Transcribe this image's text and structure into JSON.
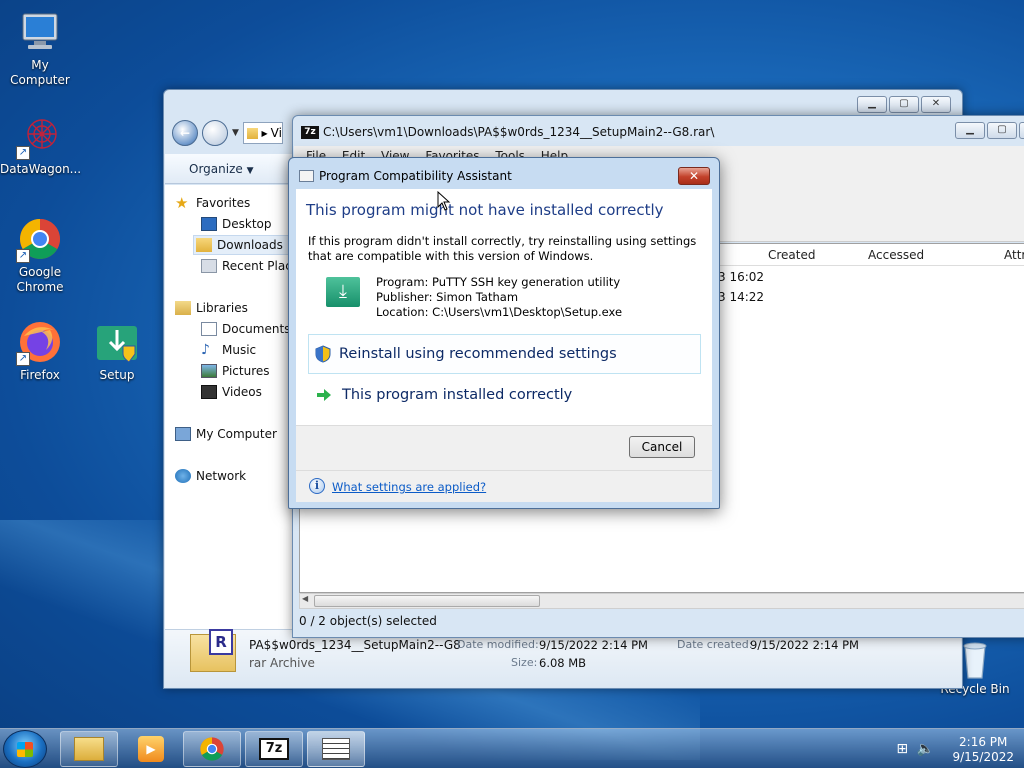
{
  "desktop": {
    "icons": [
      {
        "label": "My Computer"
      },
      {
        "label": "DataWagon..."
      },
      {
        "label": "Google Chrome"
      },
      {
        "label": "Firefox"
      },
      {
        "label": "Setup"
      },
      {
        "label": "Recycle Bin"
      }
    ]
  },
  "explorer": {
    "address_fragment": "Vi",
    "organize_label": "Organize",
    "nav": {
      "favorites": "Favorites",
      "desktop": "Desktop",
      "downloads": "Downloads",
      "recent": "Recent Places",
      "libraries": "Libraries",
      "documents": "Documents",
      "music": "Music",
      "pictures": "Pictures",
      "videos": "Videos",
      "my_computer": "My Computer",
      "network": "Network"
    },
    "details": {
      "filename": "PA$$w0rds_1234__SetupMain2--G8",
      "type": "rar Archive",
      "date_modified_label": "Date modified:",
      "date_modified": "9/15/2022 2:14 PM",
      "date_created_label": "Date created:",
      "date_created": "9/15/2022 2:14 PM",
      "size_label": "Size:",
      "size": "6.08 MB"
    }
  },
  "sevenzip": {
    "app_icon": "7z",
    "title": "C:\\Users\\vm1\\Downloads\\PA$$w0rds_1234__SetupMain2--G8.rar\\",
    "menu": [
      "File",
      "Edit",
      "View",
      "Favorites",
      "Tools",
      "Help"
    ],
    "columns": [
      "Created",
      "Accessed",
      "Attri"
    ],
    "rows": [
      {
        "time": "3 16:02"
      },
      {
        "time": "3 14:22"
      }
    ],
    "status": "0 / 2 object(s) selected"
  },
  "dialog": {
    "title": "Program Compatibility Assistant",
    "heading": "This program might not have installed correctly",
    "text": "If this program didn't install correctly, try reinstalling using settings that are compatible with this version of Windows.",
    "program": "Program: PuTTY SSH key generation utility",
    "publisher": "Publisher: Simon Tatham",
    "location": "Location: C:\\Users\\vm1\\Desktop\\Setup.exe",
    "option_reinstall": "Reinstall using recommended settings",
    "option_correct": "This program installed correctly",
    "cancel": "Cancel",
    "link": "What settings are applied?"
  },
  "taskbar": {
    "time": "2:16 PM",
    "date": "9/15/2022"
  }
}
